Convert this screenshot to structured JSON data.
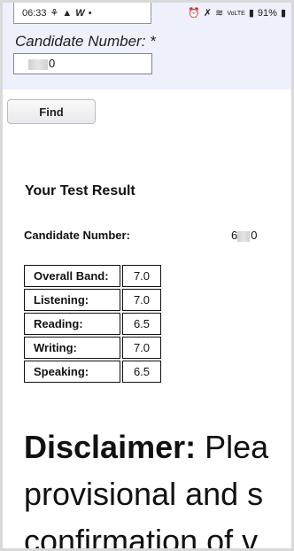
{
  "status_bar": {
    "time": "06:33",
    "left_icons": [
      "usb-icon",
      "navigation-icon",
      "w-app-icon",
      "dot-icon"
    ],
    "right_icons": [
      "alarm-icon",
      "mute-icon",
      "wifi-icon",
      "volte-icon",
      "signal-icon"
    ],
    "battery": "91%"
  },
  "search_form": {
    "candidate_label": "Candidate Number: *",
    "candidate_value_visible": "0",
    "find_label": "Find"
  },
  "result": {
    "title": "Your Test Result",
    "candidate_label": "Candidate Number:",
    "candidate_value_prefix": "6",
    "candidate_value_suffix": "0",
    "scores": [
      {
        "label": "Overall Band:",
        "value": "7.0"
      },
      {
        "label": "Listening:",
        "value": "7.0"
      },
      {
        "label": "Reading:",
        "value": "6.5"
      },
      {
        "label": "Writing:",
        "value": "7.0"
      },
      {
        "label": "Speaking:",
        "value": "6.5"
      }
    ]
  },
  "disclaimer": {
    "heading": "Disclaimer:",
    "line1_rest": "Plea",
    "line2": "provisional and s",
    "line3": "confirmation of v"
  }
}
